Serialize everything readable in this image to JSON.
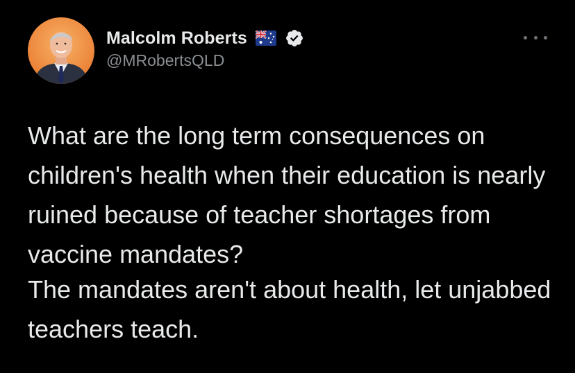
{
  "tweet": {
    "author": {
      "display_name": "Malcolm Roberts",
      "handle": "@MRobertsQLD",
      "flag_icon": "australian-flag-icon",
      "verified_icon": "verified-badge-icon"
    },
    "more_icon": "more-options-icon",
    "paragraphs": [
      "What are the long term consequences on children's health when their education is nearly ruined because of teacher shortages from vaccine mandates?",
      "The mandates aren't about health, let unjabbed teachers teach."
    ]
  },
  "colors": {
    "background": "#000000",
    "text": "#e7e9ea",
    "secondary_text": "#8b8f93",
    "avatar_background": "#f08a3c"
  }
}
